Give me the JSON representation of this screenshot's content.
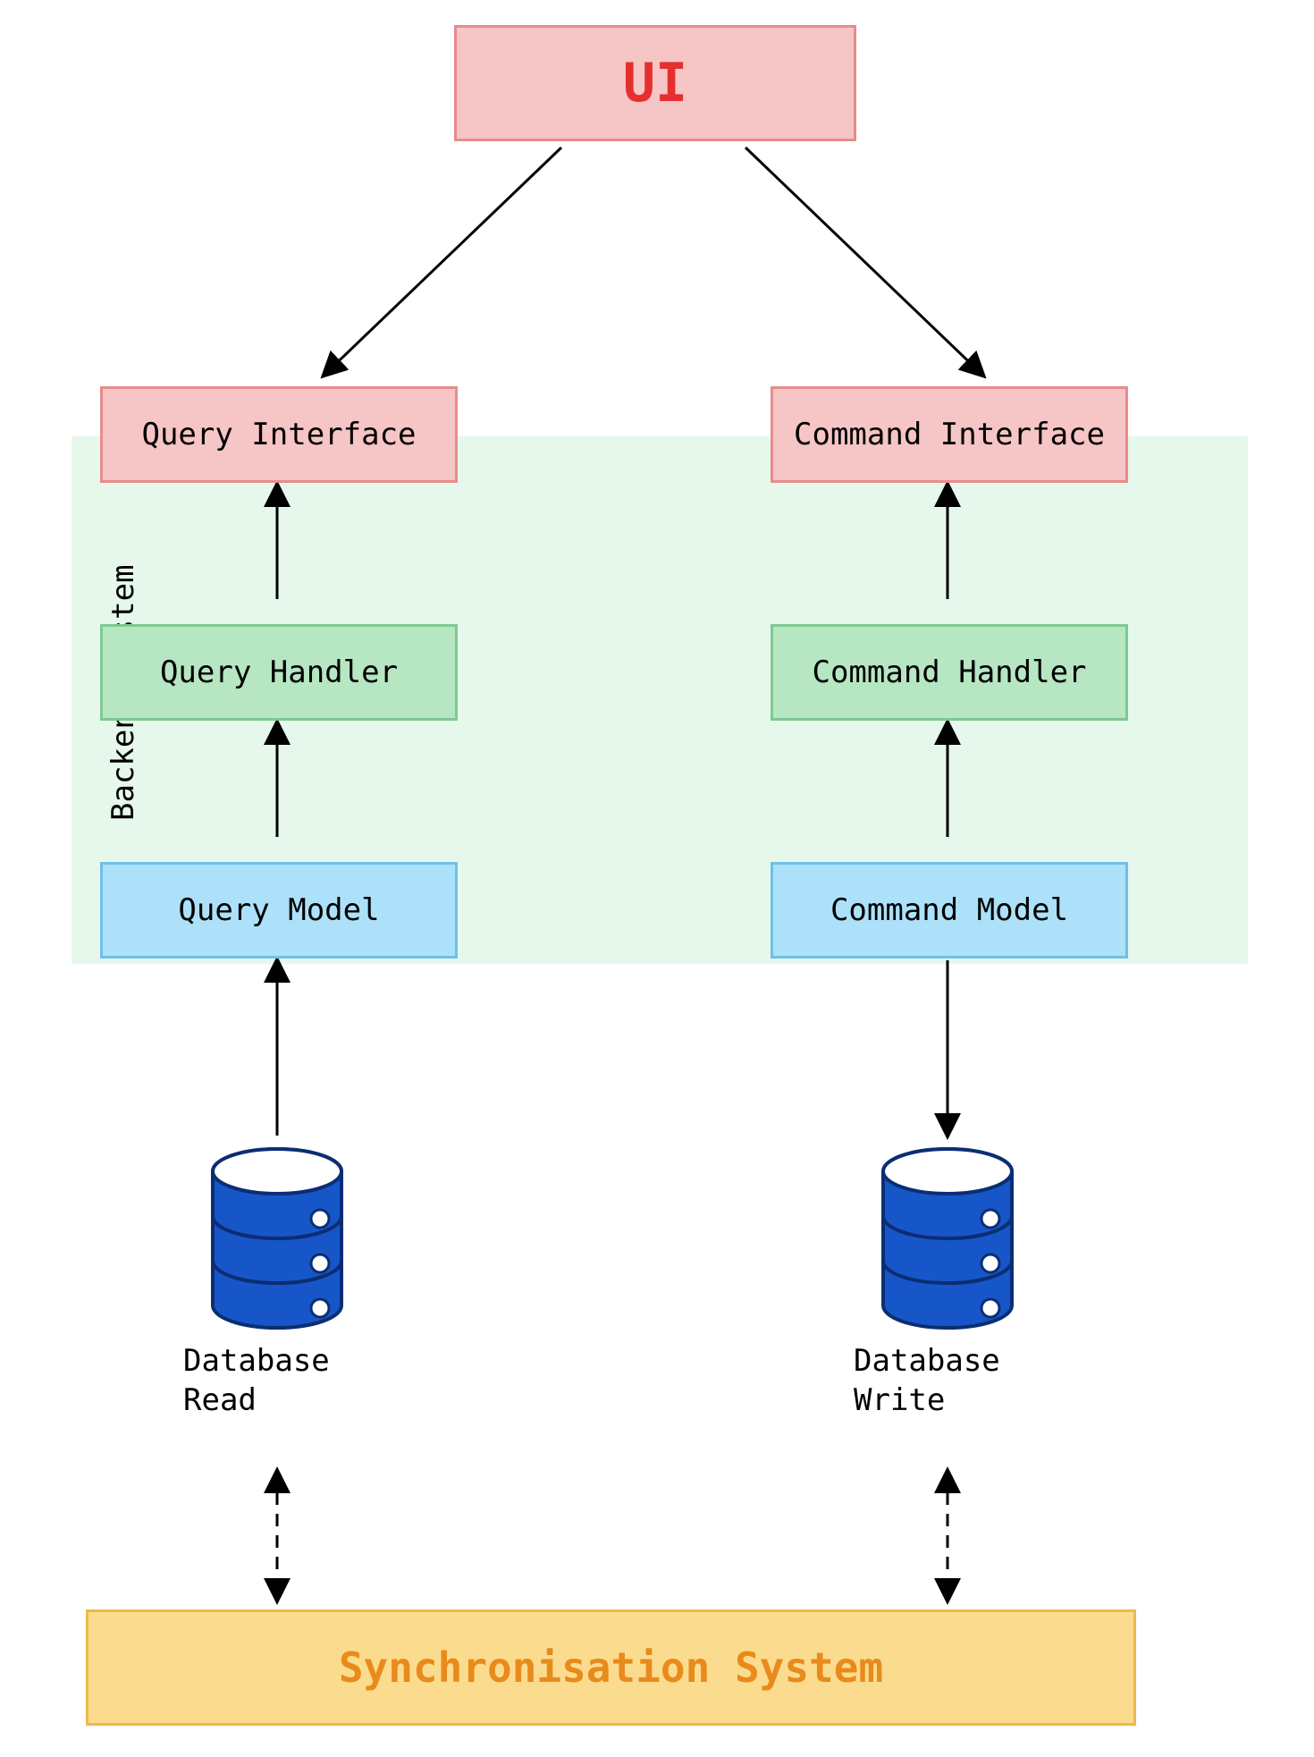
{
  "diagram": {
    "ui_label": "UI",
    "backend_label": "Backend system",
    "query_column": {
      "interface": "Query Interface",
      "handler": "Query Handler",
      "model": "Query Model",
      "db_label": "Database\nRead"
    },
    "command_column": {
      "interface": "Command Interface",
      "handler": "Command Handler",
      "model": "Command Model",
      "db_label": "Database\nWrite"
    },
    "sync_label": "Synchronisation System",
    "colors": {
      "pink_fill": "#f6c5c5",
      "pink_border": "#e88b8b",
      "ui_text": "#e52f2f",
      "green_fill": "#b7e6c3",
      "green_border": "#7ec98f",
      "blue_fill": "#ace1f9",
      "blue_border": "#6fc0e8",
      "yellow_fill": "#fbdc8e",
      "yellow_border": "#ecb94b",
      "yellow_text": "#e88b1c",
      "backend_fill": "#e6f8eb",
      "db_blue": "#1756c9",
      "arrow": "#000000"
    },
    "nodes": [
      {
        "id": "ui",
        "type": "ui",
        "label_path": "diagram.ui_label"
      },
      {
        "id": "q_if",
        "type": "pink",
        "label_path": "diagram.query_column.interface"
      },
      {
        "id": "c_if",
        "type": "pink",
        "label_path": "diagram.command_column.interface"
      },
      {
        "id": "q_handler",
        "type": "green",
        "label_path": "diagram.query_column.handler"
      },
      {
        "id": "c_handler",
        "type": "green",
        "label_path": "diagram.command_column.handler"
      },
      {
        "id": "q_model",
        "type": "blue",
        "label_path": "diagram.query_column.model"
      },
      {
        "id": "c_model",
        "type": "blue",
        "label_path": "diagram.command_column.model"
      },
      {
        "id": "db_read",
        "type": "db",
        "label_path": "diagram.query_column.db_label"
      },
      {
        "id": "db_write",
        "type": "db",
        "label_path": "diagram.command_column.db_label"
      },
      {
        "id": "sync",
        "type": "yellow",
        "label_path": "diagram.sync_label"
      }
    ],
    "edges": [
      {
        "from": "ui",
        "to": "q_if",
        "style": "solid",
        "directions": "to"
      },
      {
        "from": "ui",
        "to": "c_if",
        "style": "solid",
        "directions": "to"
      },
      {
        "from": "q_handler",
        "to": "q_if",
        "style": "solid",
        "directions": "to"
      },
      {
        "from": "c_handler",
        "to": "c_if",
        "style": "solid",
        "directions": "to"
      },
      {
        "from": "q_model",
        "to": "q_handler",
        "style": "solid",
        "directions": "to"
      },
      {
        "from": "c_model",
        "to": "c_handler",
        "style": "solid",
        "directions": "to"
      },
      {
        "from": "db_read",
        "to": "q_model",
        "style": "solid",
        "directions": "to"
      },
      {
        "from": "c_model",
        "to": "db_write",
        "style": "solid",
        "directions": "to"
      },
      {
        "from": "db_read",
        "to": "sync",
        "style": "dashed",
        "directions": "both"
      },
      {
        "from": "db_write",
        "to": "sync",
        "style": "dashed",
        "directions": "both"
      }
    ]
  }
}
